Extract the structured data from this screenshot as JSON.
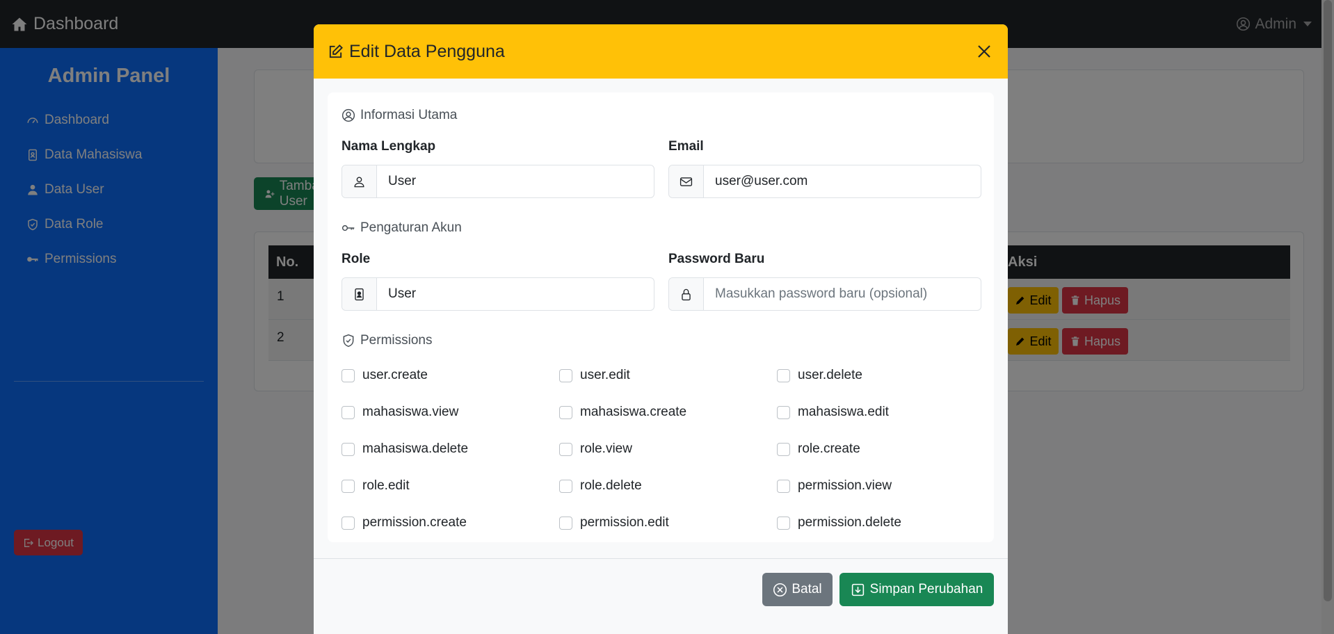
{
  "topbar": {
    "brand": "Dashboard",
    "user": "Admin"
  },
  "sidebar": {
    "title": "Admin Panel",
    "items": [
      {
        "label": "Dashboard",
        "icon": "speedometer-icon"
      },
      {
        "label": "Data Mahasiswa",
        "icon": "person-badge-icon"
      },
      {
        "label": "Data User",
        "icon": "person-icon"
      },
      {
        "label": "Data Role",
        "icon": "shield-icon"
      },
      {
        "label": "Permissions",
        "icon": "key-icon"
      }
    ],
    "logout": "Logout"
  },
  "page": {
    "add_button": "Tambah User",
    "table": {
      "headers": {
        "no": "No.",
        "aksi": "Aksi"
      },
      "rows": [
        {
          "no": "1",
          "edit": "Edit",
          "delete": "Hapus"
        },
        {
          "no": "2",
          "edit": "Edit",
          "delete": "Hapus"
        }
      ]
    }
  },
  "modal": {
    "title": "Edit Data Pengguna",
    "section_main": "Informasi Utama",
    "name_label": "Nama Lengkap",
    "name_value": "User",
    "email_label": "Email",
    "email_value": "user@user.com",
    "section_account": "Pengaturan Akun",
    "role_label": "Role",
    "role_value": "User",
    "password_label": "Password Baru",
    "password_placeholder": "Masukkan password baru (opsional)",
    "section_permissions": "Permissions",
    "permissions": [
      "user.create",
      "user.edit",
      "user.delete",
      "mahasiswa.view",
      "mahasiswa.create",
      "mahasiswa.edit",
      "mahasiswa.delete",
      "role.view",
      "role.create",
      "role.edit",
      "role.delete",
      "permission.view",
      "permission.create",
      "permission.edit",
      "permission.delete"
    ],
    "cancel": "Batal",
    "save": "Simpan Perubahan"
  },
  "colors": {
    "primary": "#0d6efd",
    "warning": "#ffc107",
    "success": "#198754",
    "danger": "#dc3545",
    "secondary": "#6c757d",
    "dark": "#212529"
  }
}
